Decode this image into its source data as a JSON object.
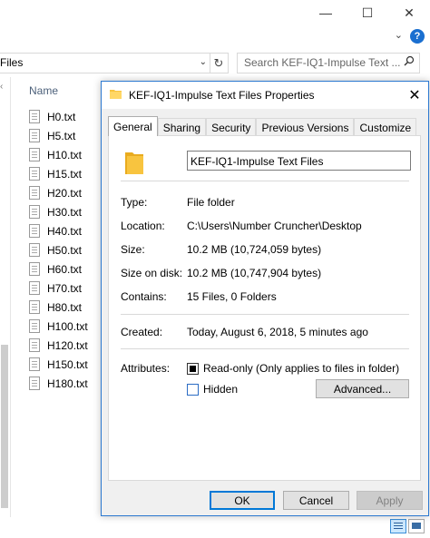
{
  "explorer": {
    "caption_buttons": {
      "minimize": "—",
      "maximize": "☐",
      "close": "✕"
    },
    "address": {
      "text": "Files"
    },
    "search": {
      "placeholder": "Search KEF-IQ1-Impulse Text ..."
    },
    "column_header": "Name",
    "files": [
      "H0.txt",
      "H5.txt",
      "H10.txt",
      "H15.txt",
      "H20.txt",
      "H30.txt",
      "H40.txt",
      "H50.txt",
      "H60.txt",
      "H70.txt",
      "H80.txt",
      "H100.txt",
      "H120.txt",
      "H150.txt",
      "H180.txt"
    ]
  },
  "dialog": {
    "title": "KEF-IQ1-Impulse Text Files Properties",
    "tabs": [
      "General",
      "Sharing",
      "Security",
      "Previous Versions",
      "Customize"
    ],
    "folder_name": "KEF-IQ1-Impulse Text Files",
    "properties": {
      "type": {
        "label": "Type:",
        "value": "File folder"
      },
      "location": {
        "label": "Location:",
        "value": "C:\\Users\\Number Cruncher\\Desktop"
      },
      "size": {
        "label": "Size:",
        "value": "10.2 MB (10,724,059 bytes)"
      },
      "size_on_disk": {
        "label": "Size on disk:",
        "value": "10.2 MB (10,747,904 bytes)"
      },
      "contains": {
        "label": "Contains:",
        "value": "15 Files, 0 Folders"
      },
      "created": {
        "label": "Created:",
        "value": "Today, August 6, 2018, 5 minutes ago"
      }
    },
    "attributes": {
      "label": "Attributes:",
      "readonly": {
        "label": "Read-only (Only applies to files in folder)",
        "checked": true
      },
      "hidden": {
        "label": "Hidden",
        "checked": false
      },
      "advanced_button": "Advanced..."
    },
    "buttons": {
      "ok": "OK",
      "cancel": "Cancel",
      "apply": "Apply"
    }
  },
  "colors": {
    "accent": "#0078d7",
    "folder": "#f8c43f",
    "help_badge": "#1a6fd0"
  }
}
